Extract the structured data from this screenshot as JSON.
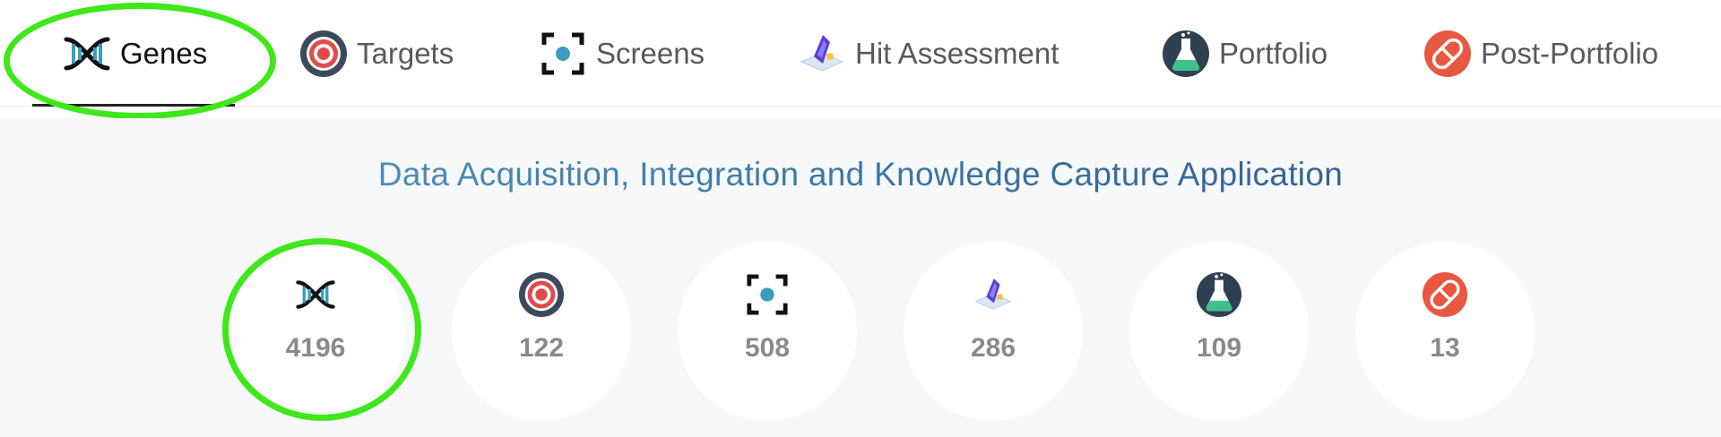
{
  "nav": {
    "tabs": [
      {
        "label": "Genes",
        "icon": "dna-icon",
        "active": true
      },
      {
        "label": "Targets",
        "icon": "target-icon"
      },
      {
        "label": "Screens",
        "icon": "screen-focus-icon"
      },
      {
        "label": "Hit Assessment",
        "icon": "hit-crystal-icon"
      },
      {
        "label": "Portfolio",
        "icon": "flask-icon"
      },
      {
        "label": "Post-Portfolio",
        "icon": "pill-icon"
      }
    ]
  },
  "main": {
    "headline": "Data Acquisition, Integration and Knowledge Capture Application",
    "stats": [
      {
        "icon": "dna-icon",
        "value": "4196"
      },
      {
        "icon": "target-icon",
        "value": "122"
      },
      {
        "icon": "screen-focus-icon",
        "value": "508"
      },
      {
        "icon": "hit-crystal-icon",
        "value": "286"
      },
      {
        "icon": "flask-icon",
        "value": "109"
      },
      {
        "icon": "pill-icon",
        "value": "13"
      }
    ]
  },
  "colors": {
    "annotation": "#3ee81a",
    "headline_start": "#5aa0c4",
    "headline_end": "#2d4f86",
    "stat_number": "#8a8a8a"
  }
}
